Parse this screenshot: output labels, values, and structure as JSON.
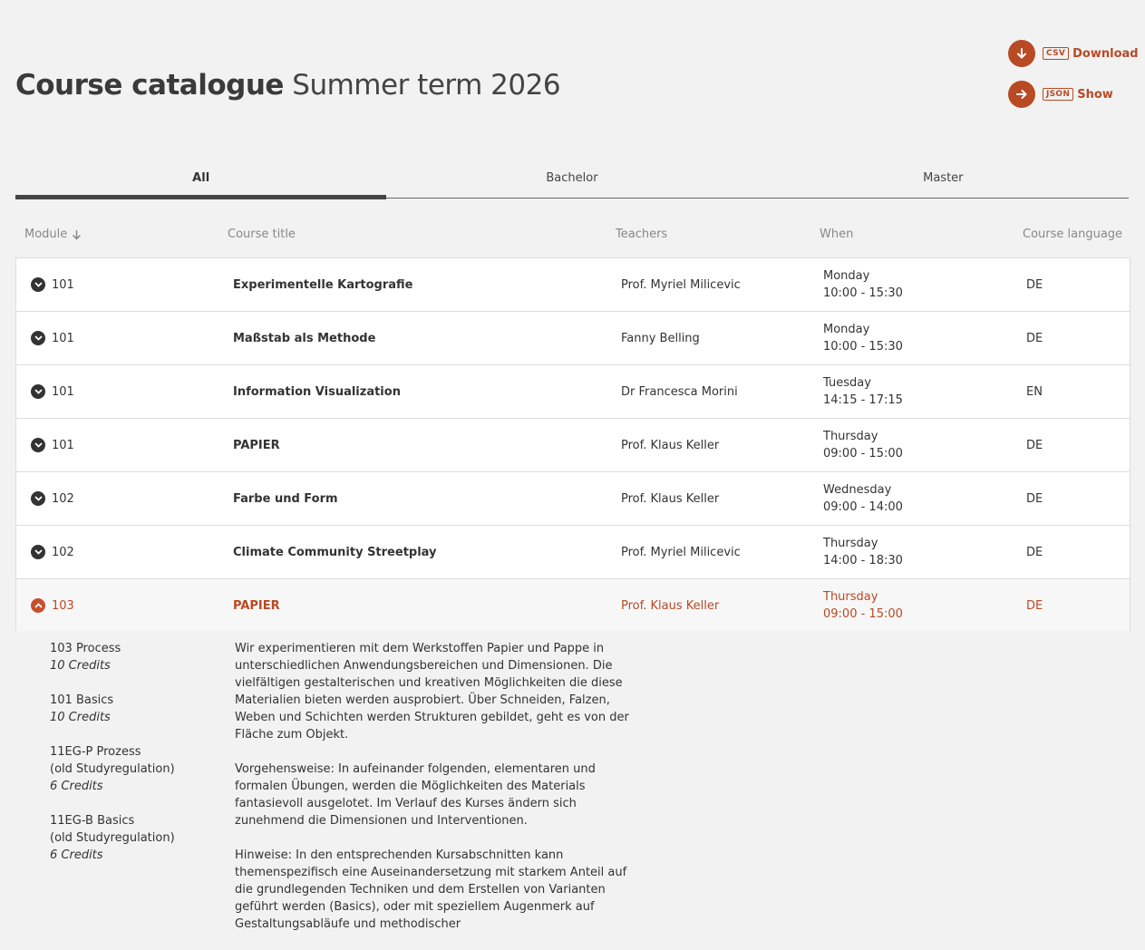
{
  "page": {
    "title_strong": "Course catalogue",
    "title_light": "Summer term 2026"
  },
  "actions": [
    {
      "format": "CSV",
      "label": "Download",
      "icon": "arrow-down-icon"
    },
    {
      "format": "JSON",
      "label": "Show",
      "icon": "arrow-right-icon"
    }
  ],
  "tabs": [
    {
      "label": "All",
      "active": true
    },
    {
      "label": "Bachelor",
      "active": false
    },
    {
      "label": "Master",
      "active": false
    }
  ],
  "columns": {
    "module": "Module",
    "title": "Course title",
    "teachers": "Teachers",
    "when": "When",
    "language": "Course language"
  },
  "courses": [
    {
      "module": "101",
      "title": "Experimentelle Kartografie",
      "teacher": "Prof. Myriel Milicevic",
      "day": "Monday",
      "time": "10:00 - 15:30",
      "lang": "DE"
    },
    {
      "module": "101",
      "title": "Maßstab als Methode",
      "teacher": "Fanny Belling",
      "day": "Monday",
      "time": "10:00 - 15:30",
      "lang": "DE"
    },
    {
      "module": "101",
      "title": "Information Visualization",
      "teacher": "Dr Francesca Morini",
      "day": "Tuesday",
      "time": "14:15 - 17:15",
      "lang": "EN"
    },
    {
      "module": "101",
      "title": "PAPIER",
      "teacher": "Prof. Klaus Keller",
      "day": "Thursday",
      "time": "09:00 - 15:00",
      "lang": "DE"
    },
    {
      "module": "102",
      "title": "Farbe und Form",
      "teacher": "Prof. Klaus Keller",
      "day": "Wednesday",
      "time": "09:00 - 14:00",
      "lang": "DE"
    },
    {
      "module": "102",
      "title": "Climate Community Streetplay",
      "teacher": "Prof. Myriel Milicevic",
      "day": "Thursday",
      "time": "14:00 - 18:30",
      "lang": "DE"
    },
    {
      "module": "103",
      "title": "PAPIER",
      "teacher": "Prof. Klaus Keller",
      "day": "Thursday",
      "time": "09:00 - 15:00",
      "lang": "DE"
    }
  ],
  "details": {
    "credits": [
      {
        "line1": "103 Process",
        "line2": "",
        "credits": "10 Credits"
      },
      {
        "line1": "101 Basics",
        "line2": "",
        "credits": "10 Credits"
      },
      {
        "line1": "11EG-P Prozess",
        "line2": "(old Studyregulation)",
        "credits": "6 Credits"
      },
      {
        "line1": "11EG-B Basics",
        "line2": "(old Studyregulation)",
        "credits": "6 Credits"
      }
    ],
    "paragraphs": [
      "Wir experimentieren mit dem Werkstoffen Papier und Pappe in unter­schiedlichen Anwendungsbereichen und Dimensionen. Die vielfältigen gestalterischen und kreativen Möglichkeiten die diese Materialien bieten werden ausprobiert. Über Schneiden, Falzen, Weben und Schichten wer­den Strukturen gebildet, geht es von der Fläche zum Objekt.",
      "Vorgehensweise: In aufeinander folgenden, elementaren und formalen Übungen, werden die Möglichkeiten des Materials fantasievoll aus­gelotet. Im Verlauf des Kurses ändern sich zunehmend die Dimensionen und Interventionen.",
      "Hinweise: In den entsprechenden Kursabschnitten kann themenspezifisch eine Auseinandersetzung mit starkem Anteil auf die grundlegenden Techniken und dem Erstellen von Varianten geführt werden (Basics), oder mit speziellem Augenmerk auf Gestaltungsabläufe und methodischer"
    ]
  }
}
